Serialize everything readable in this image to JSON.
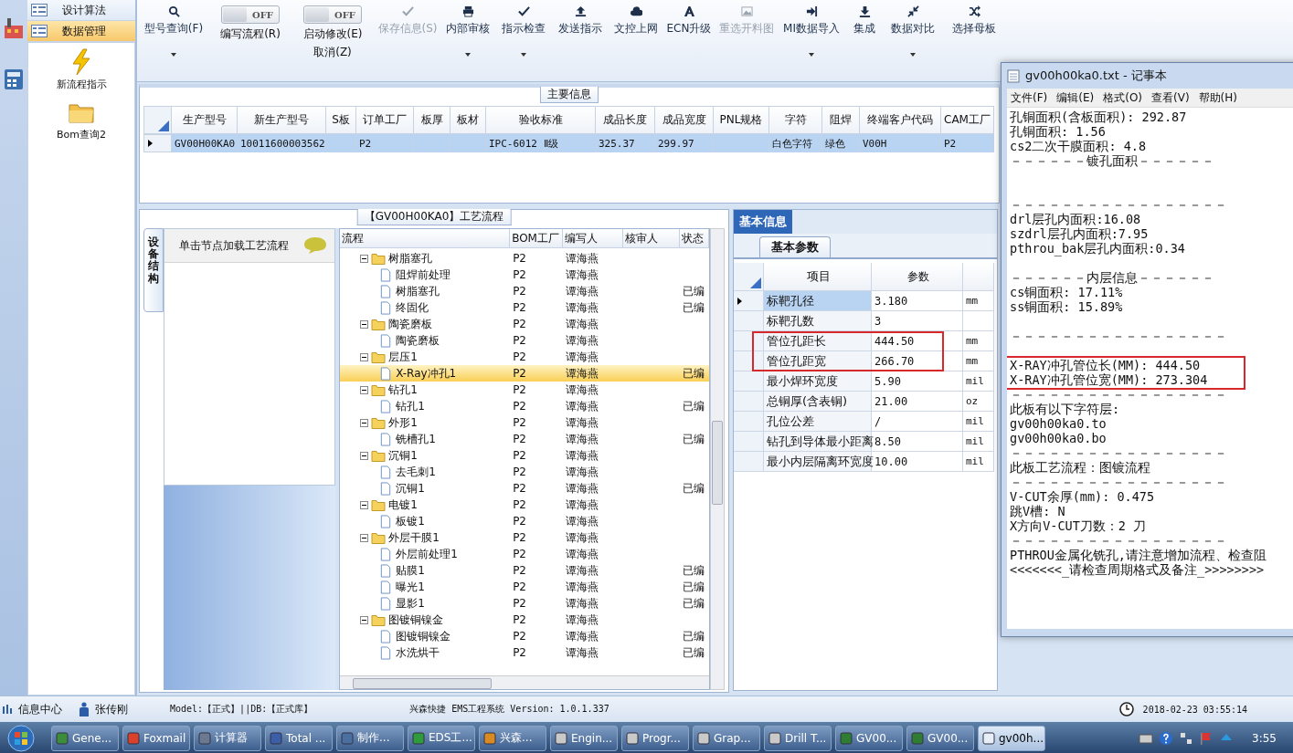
{
  "nav": {
    "items": [
      {
        "label": "设计算法",
        "selected": false
      },
      {
        "label": "数据管理",
        "selected": true
      }
    ],
    "shortcuts": [
      {
        "label": "新流程指示"
      },
      {
        "label": "Bom查询2"
      }
    ]
  },
  "toolbar": [
    {
      "kind": "button",
      "label": "型号查询(F)",
      "disabled": false,
      "dropdown": true
    },
    {
      "kind": "toggle",
      "switch_text": "OFF",
      "on": false,
      "label": "编写流程(R)"
    },
    {
      "kind": "toggle",
      "switch_text": "OFF",
      "on": false,
      "label": "启动修改(E)",
      "sublabel": "取消(Z)"
    },
    {
      "kind": "button",
      "label": "保存信息(S)",
      "disabled": true,
      "dropdown": false
    },
    {
      "kind": "button",
      "label": "内部审核",
      "disabled": false,
      "dropdown": true
    },
    {
      "kind": "button",
      "label": "指示检查",
      "disabled": false,
      "dropdown": true
    },
    {
      "kind": "button",
      "label": "发送指示",
      "disabled": false,
      "dropdown": false
    },
    {
      "kind": "button",
      "label": "文控上网",
      "disabled": false,
      "dropdown": false
    },
    {
      "kind": "button",
      "label": "ECN升级",
      "disabled": false,
      "dropdown": false
    },
    {
      "kind": "button",
      "label": "重选开料图",
      "disabled": true,
      "dropdown": false
    },
    {
      "kind": "button",
      "label": "MI数据导入",
      "disabled": false,
      "dropdown": true
    },
    {
      "kind": "button",
      "label": "集成",
      "disabled": false,
      "dropdown": false
    },
    {
      "kind": "button",
      "label": "数据对比",
      "disabled": false,
      "dropdown": true
    },
    {
      "kind": "button",
      "label": "选择母板",
      "disabled": false,
      "dropdown": false
    }
  ],
  "main_info": {
    "title": "主要信息",
    "columns": [
      "生产型号",
      "新生产型号",
      "S板",
      "订单工厂",
      "板厚",
      "板材",
      "验收标准",
      "成品长度",
      "成品宽度",
      "PNL规格",
      "字符",
      "阻焊",
      "终端客户代码",
      "CAM工厂"
    ],
    "rows": [
      {
        "selected": true,
        "cells": [
          "GV00H00KA0",
          "10011600003562",
          null,
          "P2",
          null,
          null,
          "IPC-6012 Ⅱ级",
          "325.37",
          "299.97",
          null,
          "白色字符",
          "绿色",
          "V00H",
          "P2"
        ]
      }
    ]
  },
  "process": {
    "title": "【GV00H00KA0】工艺流程",
    "side_tab": "设备结构",
    "hint": "单击节点加载工艺流程",
    "columns": [
      "流程",
      "BOM工厂",
      "编写人",
      "核审人",
      "状态"
    ],
    "tree": [
      {
        "label": "树脂塞孔",
        "factory": "P2",
        "writer": "谭海燕",
        "selected": false,
        "expanded": true,
        "children": [
          {
            "label": "阻焊前处理",
            "factory": "P2",
            "writer": "谭海燕",
            "selected": false
          },
          {
            "label": "树脂塞孔",
            "factory": "P2",
            "writer": "谭海燕",
            "status": "已编",
            "selected": false
          },
          {
            "label": "终固化",
            "factory": "P2",
            "writer": "谭海燕",
            "status": "已编",
            "selected": false
          }
        ]
      },
      {
        "label": "陶瓷磨板",
        "factory": "P2",
        "writer": "谭海燕",
        "selected": false,
        "expanded": true,
        "children": [
          {
            "label": "陶瓷磨板",
            "factory": "P2",
            "writer": "谭海燕",
            "selected": false
          }
        ]
      },
      {
        "label": "层压1",
        "factory": "P2",
        "writer": "谭海燕",
        "selected": false,
        "expanded": true,
        "children": [
          {
            "label": "X-Ray冲孔1",
            "factory": "P2",
            "writer": "谭海燕",
            "status": "已编",
            "selected": true
          }
        ]
      },
      {
        "label": "钻孔1",
        "factory": "P2",
        "writer": "谭海燕",
        "selected": false,
        "expanded": true,
        "children": [
          {
            "label": "钻孔1",
            "factory": "P2",
            "writer": "谭海燕",
            "status": "已编",
            "selected": false
          }
        ]
      },
      {
        "label": "外形1",
        "factory": "P2",
        "writer": "谭海燕",
        "selected": false,
        "expanded": true,
        "children": [
          {
            "label": "铣槽孔1",
            "factory": "P2",
            "writer": "谭海燕",
            "status": "已编",
            "selected": false
          }
        ]
      },
      {
        "label": "沉铜1",
        "factory": "P2",
        "writer": "谭海燕",
        "selected": false,
        "expanded": true,
        "children": [
          {
            "label": "去毛刺1",
            "factory": "P2",
            "writer": "谭海燕",
            "selected": false
          },
          {
            "label": "沉铜1",
            "factory": "P2",
            "writer": "谭海燕",
            "status": "已编",
            "selected": false
          }
        ]
      },
      {
        "label": "电镀1",
        "factory": "P2",
        "writer": "谭海燕",
        "selected": false,
        "expanded": true,
        "children": [
          {
            "label": "板镀1",
            "factory": "P2",
            "writer": "谭海燕",
            "selected": false
          }
        ]
      },
      {
        "label": "外层干膜1",
        "factory": "P2",
        "writer": "谭海燕",
        "selected": false,
        "expanded": true,
        "children": [
          {
            "label": "外层前处理1",
            "factory": "P2",
            "writer": "谭海燕",
            "selected": false
          },
          {
            "label": "贴膜1",
            "factory": "P2",
            "writer": "谭海燕",
            "status": "已编",
            "selected": false
          },
          {
            "label": "曝光1",
            "factory": "P2",
            "writer": "谭海燕",
            "status": "已编",
            "selected": false
          },
          {
            "label": "显影1",
            "factory": "P2",
            "writer": "谭海燕",
            "status": "已编",
            "selected": false
          }
        ]
      },
      {
        "label": "图镀铜镍金",
        "factory": "P2",
        "writer": "谭海燕",
        "selected": false,
        "expanded": true,
        "children": [
          {
            "label": "图镀铜镍金",
            "factory": "P2",
            "writer": "谭海燕",
            "status": "已编",
            "selected": false
          },
          {
            "label": "水洗烘干",
            "factory": "P2",
            "writer": "谭海燕",
            "status": "已编",
            "selected": false
          }
        ]
      }
    ]
  },
  "basic_info": {
    "tabs": [
      {
        "label": "基本信息",
        "selected": true
      }
    ],
    "subtabs": [
      {
        "label": "基本参数",
        "selected": true
      }
    ],
    "columns": [
      "项目",
      "参数"
    ],
    "rows": [
      {
        "item": "标靶孔径",
        "value": "3.180",
        "unit": "mm",
        "selected": true,
        "highlighted": false
      },
      {
        "item": "标靶孔数",
        "value": "3",
        "selected": false,
        "highlighted": false
      },
      {
        "item": "管位孔距长",
        "value": "444.50",
        "unit": "mm",
        "selected": false,
        "highlighted": true
      },
      {
        "item": "管位孔距宽",
        "value": "266.70",
        "unit": "mm",
        "selected": false,
        "highlighted": true
      },
      {
        "item": "最小焊环宽度",
        "value": "5.90",
        "unit": "mil",
        "selected": false,
        "highlighted": false
      },
      {
        "item": "总铜厚(含表铜)",
        "value": "21.00",
        "unit": "oz",
        "selected": false,
        "highlighted": false
      },
      {
        "item": "孔位公差",
        "value": "/",
        "unit": "mil",
        "selected": false,
        "highlighted": false
      },
      {
        "item": "钻孔到导体最小距离",
        "value": "8.50",
        "unit": "mil",
        "selected": false,
        "highlighted": false
      },
      {
        "item": "最小内层隔离环宽度",
        "value": "10.00",
        "unit": "mil",
        "selected": false,
        "highlighted": false
      }
    ]
  },
  "notepad": {
    "title": "gv00h00ka0.txt - 记事本",
    "menu": [
      "文件(F)",
      "编辑(E)",
      "格式(O)",
      "查看(V)",
      "帮助(H)"
    ],
    "blocks": [
      {
        "highlighted": false,
        "lines": [
          "孔铜面积(含板面积): 292.87",
          "孔铜面积: 1.56",
          "cs2二次干膜面积: 4.8",
          "－－－－－－镀孔面积－－－－－－"
        ]
      },
      {
        "highlighted": false,
        "lines": [
          "－－－－－－－－－－－－－－－－－",
          "drl层孔内面积:16.08",
          "szdrl层孔内面积:7.95",
          "pthrou_bak层孔内面积:0.34"
        ]
      },
      {
        "highlighted": false,
        "lines": [
          "－－－－－－内层信息－－－－－－",
          "cs铜面积: 17.11%",
          "ss铜面积: 15.89%"
        ]
      },
      {
        "highlighted": false,
        "lines": [
          "－－－－－－－－－－－－－－－－－"
        ]
      },
      {
        "highlighted": true,
        "lines": [
          "X-RAY冲孔管位长(MM): 444.50",
          "X-RAY冲孔管位宽(MM): 273.304"
        ]
      },
      {
        "highlighted": false,
        "lines": [
          "－－－－－－－－－－－－－－－－－",
          "此板有以下字符层:",
          "gv00h00ka0.to",
          "gv00h00ka0.bo",
          "－－－－－－－－－－－－－－－－－",
          "此板工艺流程：图镀流程",
          "－－－－－－－－－－－－－－－－－",
          "V-CUT余厚(mm): 0.475",
          "跳V槽: N",
          "X方向V-CUT刀数：2 刀",
          "－－－－－－－－－－－－－－－－－",
          "PTHROU金属化铣孔,请注意增加流程、检查阻",
          "<<<<<<<_请检查周期格式及备注_>>>>>>>>"
        ]
      }
    ]
  },
  "status_bar": {
    "message_center": "信息中心",
    "user": "张传刚",
    "mode": "Model:【正式】||DB:【正式库】",
    "app": "兴森快捷 EMS工程系统 Version: 1.0.1.337",
    "datetime": "2018-02-23 03:55:14"
  },
  "taskbar": {
    "items": [
      {
        "label": "Gene...",
        "active": false
      },
      {
        "label": "Foxmail",
        "active": false
      },
      {
        "label": "计算器",
        "active": false
      },
      {
        "label": "Total ...",
        "active": false
      },
      {
        "label": "制作...",
        "active": false
      },
      {
        "label": "EDS工...",
        "active": false
      },
      {
        "label": "兴森...",
        "active": false
      },
      {
        "label": "Engin...",
        "active": false
      },
      {
        "label": "Progr...",
        "active": false
      },
      {
        "label": "Grap...",
        "active": false
      },
      {
        "label": "Drill T...",
        "active": false
      },
      {
        "label": "GV00...",
        "active": false
      },
      {
        "label": "GV00...",
        "active": false
      },
      {
        "label": "gv00h...",
        "active": true
      }
    ],
    "clock": "3:55"
  }
}
